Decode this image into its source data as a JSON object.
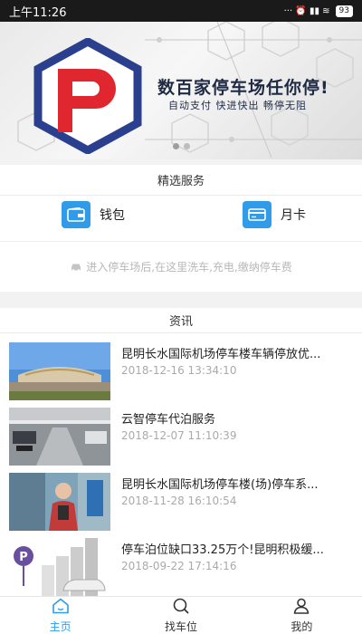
{
  "status_bar": {
    "time": "上午11:26",
    "indicators": "··· ⏰ ▮▮ ≋",
    "battery": "93"
  },
  "banner": {
    "logo_letter": "P",
    "title": "数百家停车场任你停!",
    "subtitle": "自动支付  快进快出  畅停无阻",
    "brand_colors": {
      "blue": "#2b3f8f",
      "red": "#e0272f"
    }
  },
  "services": {
    "heading": "精选服务",
    "items": [
      {
        "label": "钱包",
        "icon": "wallet-icon"
      },
      {
        "label": "月卡",
        "icon": "card-icon"
      }
    ],
    "hint": "进入停车场后,在这里洗车,充电,缴纳停车费"
  },
  "news": {
    "heading": "资讯",
    "items": [
      {
        "title": "昆明长水国际机场停车楼车辆停放优...",
        "date": "2018-12-16 13:34:10"
      },
      {
        "title": "云智停车代泊服务",
        "date": "2018-12-07 11:10:39"
      },
      {
        "title": "昆明长水国际机场停车楼(场)停车系...",
        "date": "2018-11-28 16:10:54"
      },
      {
        "title": "停车泊位缺口33.25万个!昆明积极缓...",
        "date": "2018-09-22 17:14:16"
      }
    ]
  },
  "tabs": [
    {
      "label": "主页",
      "icon": "home-icon",
      "active": true
    },
    {
      "label": "找车位",
      "icon": "search-icon",
      "active": false
    },
    {
      "label": "我的",
      "icon": "user-icon",
      "active": false
    }
  ],
  "accent_color": "#2f9be9"
}
